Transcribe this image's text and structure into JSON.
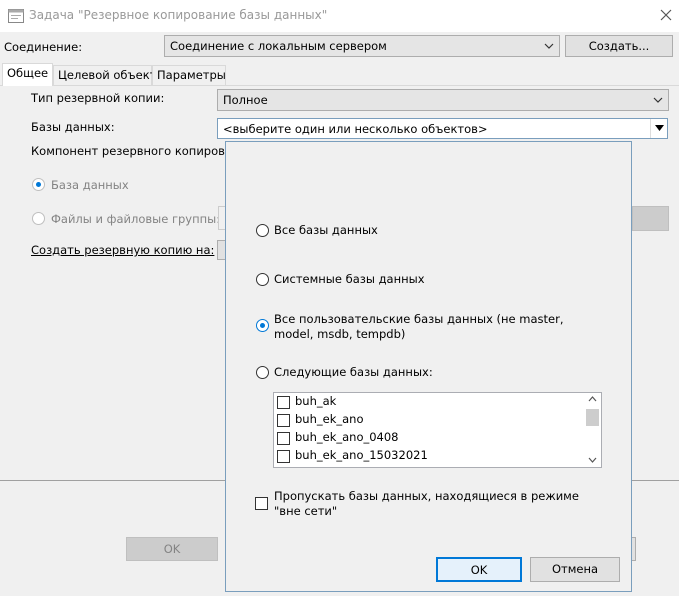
{
  "window": {
    "title": "Задача \"Резервное копирование базы данных\"",
    "close_glyph": "✕"
  },
  "connection": {
    "label": "Соединение:",
    "value": "Соединение с локальным сервером",
    "create_button": "Создать..."
  },
  "tabs": [
    {
      "label": "Общее",
      "active": true
    },
    {
      "label": "Целевой объект",
      "active": false
    },
    {
      "label": "Параметры",
      "active": false
    }
  ],
  "general": {
    "backup_type_label": "Тип резервной копии:",
    "backup_type_value": "Полное",
    "databases_label": "Базы данных:",
    "databases_value": "<выберите один или несколько объектов>",
    "component_label": "Компонент резервного копировани",
    "radio_database": "База данных",
    "radio_files": "Файлы и файловые группы:",
    "backup_to_label": "Создать резервную копию на:"
  },
  "footer": {
    "ok_label": "OK"
  },
  "popup": {
    "options": [
      {
        "label": "Все базы данных",
        "checked": false
      },
      {
        "label": "Системные базы данных",
        "checked": false
      },
      {
        "label": "Все пользовательские базы данных (не master, model, msdb, tempdb)",
        "checked": true
      },
      {
        "label": "Следующие базы данных:",
        "checked": false
      }
    ],
    "databases": [
      "buh_ak",
      "buh_ek_ano",
      "buh_ek_ano_0408",
      "buh_ek_ano_15032021"
    ],
    "skip_offline_label": "Пропускать базы данных, находящиеся в режиме \"вне сети\"",
    "ok_label": "OK",
    "cancel_label": "Отмена"
  },
  "colors": {
    "accent": "#0078d7",
    "popup_border": "#7a9ebd"
  }
}
